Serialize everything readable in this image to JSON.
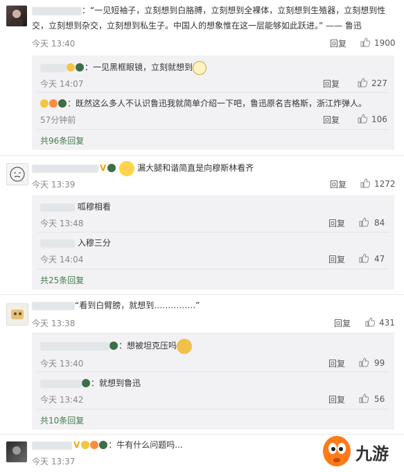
{
  "reply_label": "回复",
  "comments": [
    {
      "text_line1": "：“一见短袖子，立刻想到白胳膊，立刻想到全裸体，立刻想到生殖器，立刻想到性",
      "text_line2": "交，立刻想到杂交，立刻想到私生子。中国人的想象惟在这一层能够如此跃进。” —— 鲁迅",
      "time": "今天 13:40",
      "likes": "1900",
      "replies": [
        {
          "text": "：一见黑框眼镜，立刻就想到",
          "time": "今天 14:07",
          "likes": "227"
        },
        {
          "text": "：既然这么多人不认识鲁迅我就简单介绍一下吧，鲁迅原名吉格斯，浙江炸弹人。",
          "time": "57分钟前",
          "likes": "106"
        }
      ],
      "more": "共96条回复"
    },
    {
      "text": "漏大腿和谐简直是向穆斯林看齐",
      "time": "今天 13:39",
      "likes": "1272",
      "replies": [
        {
          "text": "呱穆相看",
          "time": "今天 13:48",
          "likes": "84"
        },
        {
          "text": "入穆三分",
          "time": "今天 14:04",
          "likes": "47"
        }
      ],
      "more": "共25条回复"
    },
    {
      "text": "“看到白臂膀，就想到……………”",
      "time": "今天 13:38",
      "likes": "431",
      "replies": [
        {
          "text": "：想被坦克压吗",
          "time": "今天 13:40",
          "likes": "99"
        },
        {
          "text": "：就想到鲁迅",
          "time": "今天 13:42",
          "likes": "56"
        }
      ],
      "more": "共10条回复"
    },
    {
      "text": "：牛有什么问题吗...",
      "time": "今天 13:37"
    }
  ],
  "watermark": {
    "text": "九游"
  },
  "colors": {
    "more_link": "#467c4a",
    "subbox_bg": "#f2f2f5",
    "vbadge": "#f0a400",
    "watermark_orange": "#ff7a1a"
  }
}
